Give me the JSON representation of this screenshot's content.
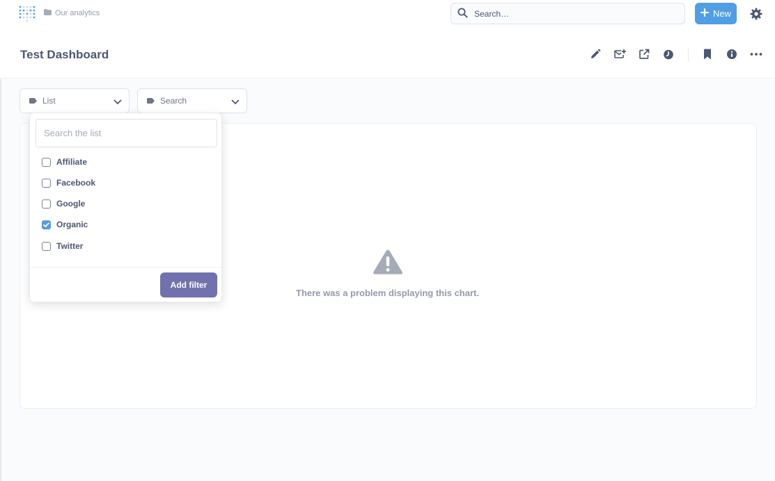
{
  "nav": {
    "breadcrumb": "Our analytics",
    "search_label": "Search…",
    "new_label": "New"
  },
  "dashboard": {
    "title": "Test Dashboard"
  },
  "filters": [
    {
      "label": "List"
    },
    {
      "label": "Search"
    }
  ],
  "popover": {
    "search_placeholder": "Search the list",
    "options": [
      {
        "label": "Affiliate",
        "checked": false
      },
      {
        "label": "Facebook",
        "checked": false
      },
      {
        "label": "Google",
        "checked": false
      },
      {
        "label": "Organic",
        "checked": true
      },
      {
        "label": "Twitter",
        "checked": false
      }
    ],
    "submit_label": "Add filter"
  },
  "card": {
    "error_message": "There was a problem displaying this chart."
  },
  "colors": {
    "brand": "#509ee3",
    "filter_button": "#7172ad",
    "text": "#4c5773",
    "muted": "#949aab"
  },
  "icons": [
    "metabase-logo-icon",
    "folder-icon",
    "search-icon",
    "plus-icon",
    "gear-icon",
    "pencil-icon",
    "subscription-icon",
    "share-icon",
    "history-icon",
    "bookmark-icon",
    "info-icon",
    "ellipsis-icon",
    "tag-icon",
    "chevron-down-icon",
    "warning-icon",
    "check-icon"
  ]
}
